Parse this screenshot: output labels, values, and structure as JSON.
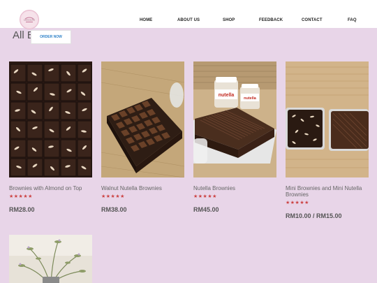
{
  "header": {
    "logo_text": "CHOCOLATE",
    "nav": [
      "HOME",
      "ABOUT US",
      "SHOP",
      "FEEDBACK",
      "CONTACT",
      "FAQ"
    ]
  },
  "page": {
    "title": "All B",
    "order_button": "ORDER NOW"
  },
  "products": [
    {
      "name": "Brownies with Almond on Top",
      "rating": 5,
      "stars": "★★★★★",
      "price": "RM28.00"
    },
    {
      "name": "Walnut Nutella Brownies",
      "rating": 5,
      "stars": "★★★★★",
      "price": "RM38.00"
    },
    {
      "name": "Nutella Brownies",
      "rating": 5,
      "stars": "★★★★★",
      "price": "RM45.00"
    },
    {
      "name": "Mini Brownies and Mini Nutella Brownies",
      "rating": 5,
      "stars": "★★★★★",
      "price": "RM10.00 / RM15.00"
    }
  ],
  "jar_labels": {
    "jar": "nutella"
  },
  "colors": {
    "background": "#e8d5e8",
    "stars": "#c44444",
    "order_button_text": "#2f82c8"
  }
}
